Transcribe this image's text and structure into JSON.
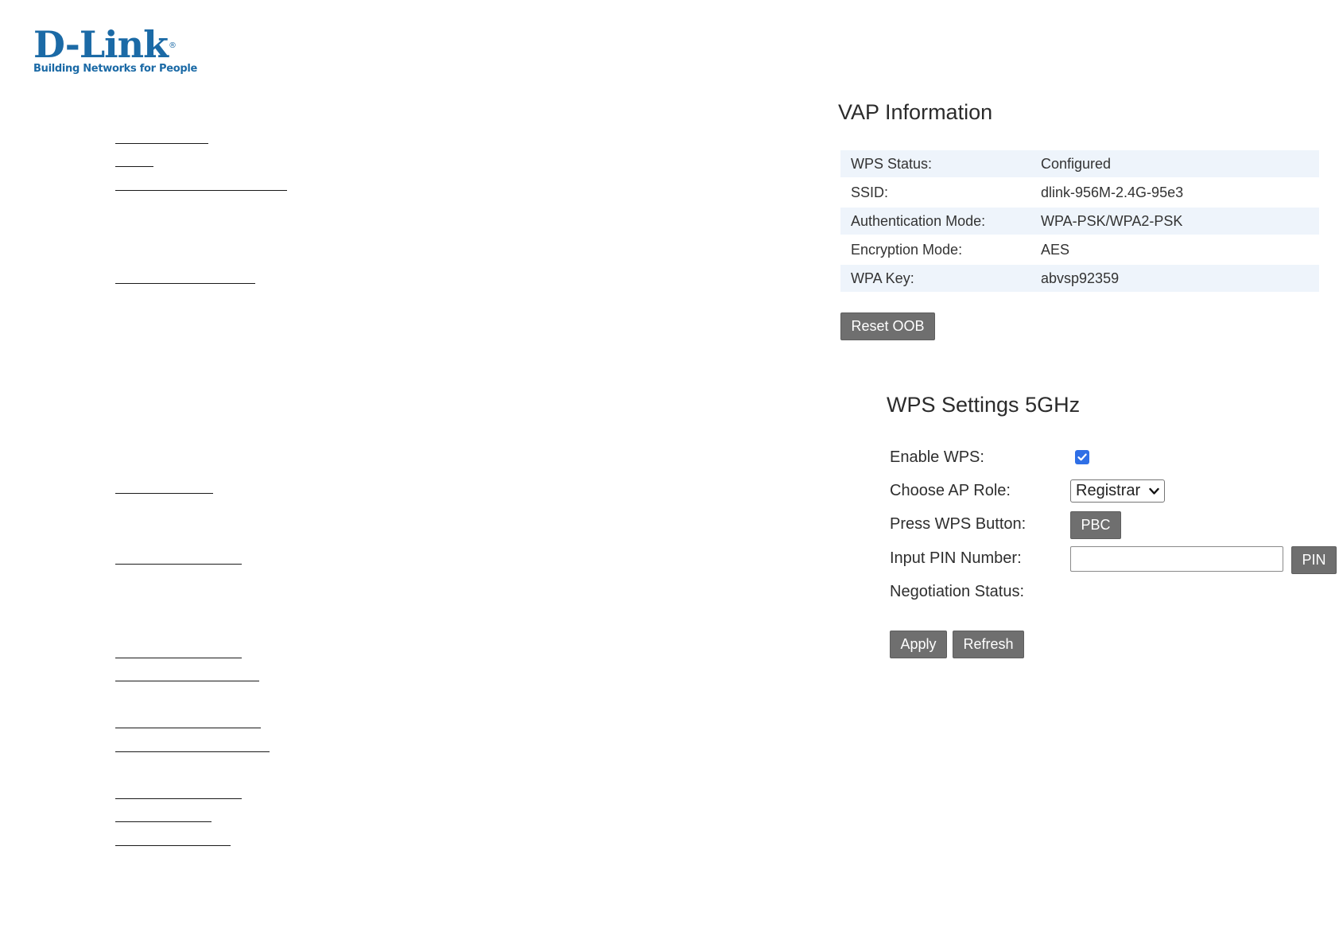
{
  "brand": {
    "logo_text": "D-Link",
    "registered_mark": "®",
    "tagline": "Building Networks for People",
    "color": "#1b6aa6"
  },
  "vap": {
    "title": "VAP Information",
    "rows": [
      {
        "label": "WPS Status:",
        "value": "Configured"
      },
      {
        "label": "SSID:",
        "value": "dlink-956M-2.4G-95e3"
      },
      {
        "label": "Authentication Mode:",
        "value": "WPA-PSK/WPA2-PSK"
      },
      {
        "label": "Encryption Mode:",
        "value": "AES"
      },
      {
        "label": "WPA Key:",
        "value": "abvsp92359"
      }
    ],
    "reset_button": "Reset OOB"
  },
  "wps": {
    "title": "WPS Settings 5GHz",
    "enable_label": "Enable WPS:",
    "enable_checked": true,
    "role_label": "Choose AP Role:",
    "role_value": "Registrar",
    "press_label": "Press WPS Button:",
    "pbc_button": "PBC",
    "pin_label": "Input PIN Number:",
    "pin_value": "",
    "pin_button": "PIN",
    "negotiation_label": "Negotiation Status:",
    "negotiation_value": "",
    "apply_button": "Apply",
    "refresh_button": "Refresh"
  },
  "colors": {
    "button_bg": "#6f6f6f",
    "row_stripe": "#eef4fb",
    "checkbox": "#2f6fe6"
  }
}
